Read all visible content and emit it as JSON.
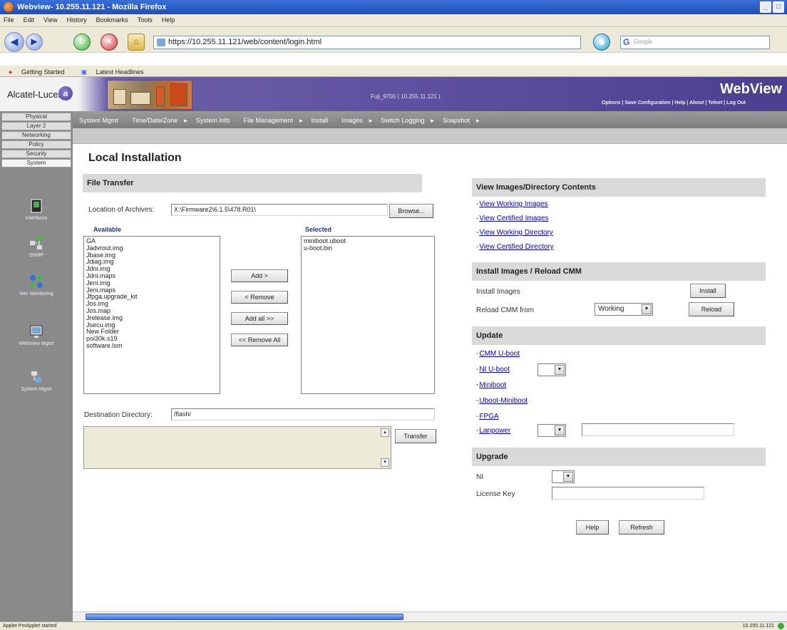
{
  "browser": {
    "title": "Webview- 10.255.11.121 - Mozilla Firefox",
    "menu": [
      "File",
      "Edit",
      "View",
      "History",
      "Bookmarks",
      "Tools",
      "Help"
    ],
    "url": "https://10.255.11.121/web/content/login.html",
    "search_placeholder": "Google",
    "bookmarks": [
      "Getting Started",
      "Latest Headlines"
    ],
    "status": "Applet PmApplet started",
    "status_right": "10.255.11.121"
  },
  "header": {
    "logo": "Alcatel-Lucent",
    "device": "Fuji_9700  ( 10.255.11.121 )",
    "brand": "WebView",
    "links": [
      "Options",
      "Save Configuration",
      "Help",
      "About",
      "Telnet",
      "Log Out"
    ]
  },
  "sidebar": {
    "tabs": [
      "Physical",
      "Layer 2",
      "Networking",
      "Policy",
      "Security",
      "System"
    ],
    "items": [
      "Interfaces",
      "SNMP",
      "Net. Monitoring",
      "WebView Mgmt",
      "System Mgmt"
    ]
  },
  "menu": {
    "items": [
      "System Mgmt",
      "Time/Date/Zone",
      "System Info",
      "File Management",
      "Install",
      "Images",
      "Switch Logging",
      "Snapshot"
    ]
  },
  "page": {
    "title": "Local Installation"
  },
  "file_transfer": {
    "header": "File Transfer",
    "archives_label": "Location of Archives:",
    "archives_value": "X:\\Firmware2\\6.1.5\\478.R01\\",
    "browse": "Browse...",
    "available_label": "Available",
    "selected_label": "Selected",
    "available": [
      "GA",
      "Jadvrout.img",
      "Jbase.img",
      "Jdiag.img",
      "Jdni.img",
      "Jdni.maps",
      "Jeni.img",
      "Jeni.maps",
      "Jfpga.upgrade_kit",
      "Jos.img",
      "Jos.map",
      "Jrelease.img",
      "Jsecu.img",
      "New Folder",
      "poi30k.s19",
      "software.lsm"
    ],
    "selected": [
      "miniboot.uboot",
      "u-boot.bin"
    ],
    "add": "Add >",
    "remove": "< Remove",
    "add_all": "Add all >>",
    "remove_all": "<< Remove All",
    "dest_label": "Destination Directory:",
    "dest_value": "/flash/",
    "transfer": "Transfer"
  },
  "view_images": {
    "header": "View Images/Directory Contents",
    "links": [
      "View Working Images",
      "View Certified Images",
      "View Working Directory",
      "View Certified Directory"
    ]
  },
  "install": {
    "header": "Install Images / Reload CMM",
    "install_label": "Install Images",
    "install_btn": "Install",
    "reload_label": "Reload CMM from",
    "reload_value": "Working",
    "reload_btn": "Reload"
  },
  "update": {
    "header": "Update",
    "links": [
      "CMM U-boot",
      "NI U-boot",
      "Miniboot",
      "Uboot-Miniboot",
      "FPGA",
      "Lanpower"
    ]
  },
  "upgrade": {
    "header": "Upgrade",
    "ni_label": "NI",
    "license_label": "License Key"
  },
  "footer": {
    "help": "Help",
    "refresh": "Refresh"
  },
  "colors": {
    "banner": "#5c4e9e",
    "sidebar": "#8a8a8a",
    "section": "#d9d9d9",
    "link": "#0000cc"
  }
}
